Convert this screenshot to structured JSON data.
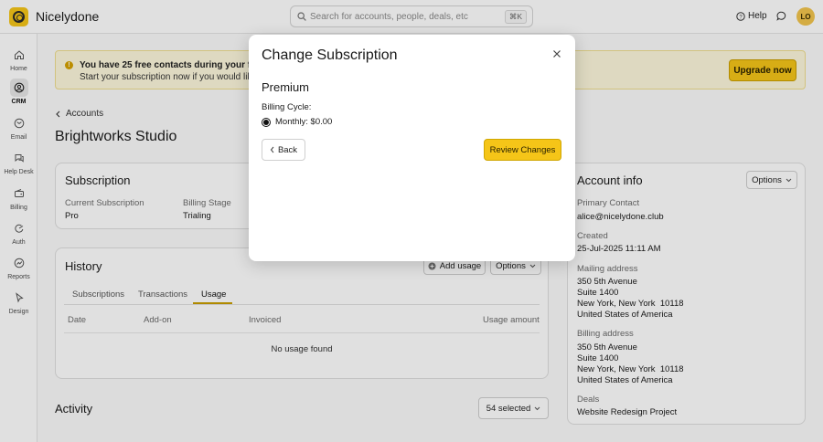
{
  "app": {
    "brand": "Nicelydone",
    "avatar_initials": "LO",
    "help_label": "Help"
  },
  "search": {
    "placeholder": "Search for accounts, people, deals, etc",
    "shortcut": "⌘K"
  },
  "sidebar": {
    "items": [
      {
        "label": "Home",
        "icon": "home-icon"
      },
      {
        "label": "CRM",
        "icon": "crm-icon",
        "active": true
      },
      {
        "label": "Email",
        "icon": "email-icon"
      },
      {
        "label": "Help Desk",
        "icon": "help-desk-icon"
      },
      {
        "label": "Billing",
        "icon": "billing-icon"
      },
      {
        "label": "Auth",
        "icon": "auth-icon"
      },
      {
        "label": "Reports",
        "icon": "reports-icon"
      },
      {
        "label": "Design",
        "icon": "design-icon"
      }
    ]
  },
  "banner": {
    "line1": "You have 25 free contacts during your free trial",
    "line2": "Start your subscription now if you would like to i",
    "upgrade_label": "Upgrade now"
  },
  "breadcrumb": {
    "label": "Accounts"
  },
  "page": {
    "title": "Brightworks Studio"
  },
  "subscription": {
    "title": "Subscription",
    "current_label": "Current Subscription",
    "current_value": "Pro",
    "stage_label": "Billing Stage",
    "stage_value": "Trialing"
  },
  "history": {
    "title": "History",
    "add_usage_label": "Add usage",
    "options_label": "Options",
    "tabs": [
      "Subscriptions",
      "Transactions",
      "Usage"
    ],
    "columns": [
      "Date",
      "Add-on",
      "Invoiced",
      "Usage amount"
    ],
    "empty_text": "No usage found"
  },
  "activity": {
    "title": "Activity",
    "selected_label": "54 selected"
  },
  "account_info": {
    "title": "Account info",
    "options_label": "Options",
    "primary_contact_label": "Primary Contact",
    "primary_contact_value": "alice@nicelydone.club",
    "created_label": "Created",
    "created_value": "25-Jul-2025 11:11 AM",
    "mailing_label": "Mailing address",
    "mailing_lines": [
      "350 5th Avenue",
      "Suite 1400",
      "New York, New York  10118",
      "United States of America"
    ],
    "billing_label": "Billing address",
    "billing_lines": [
      "350 5th Avenue",
      "Suite 1400",
      "New York, New York  10118",
      "United States of America"
    ],
    "deals_label": "Deals",
    "deals_value": "Website Redesign Project"
  },
  "modal": {
    "title": "Change Subscription",
    "plan": "Premium",
    "cycle_label": "Billing Cycle:",
    "option_label": "Monthly: $0.00",
    "back_label": "Back",
    "review_label": "Review Changes"
  },
  "colors": {
    "accent": "#f5c518",
    "banner_bg": "#fdf7dc"
  }
}
